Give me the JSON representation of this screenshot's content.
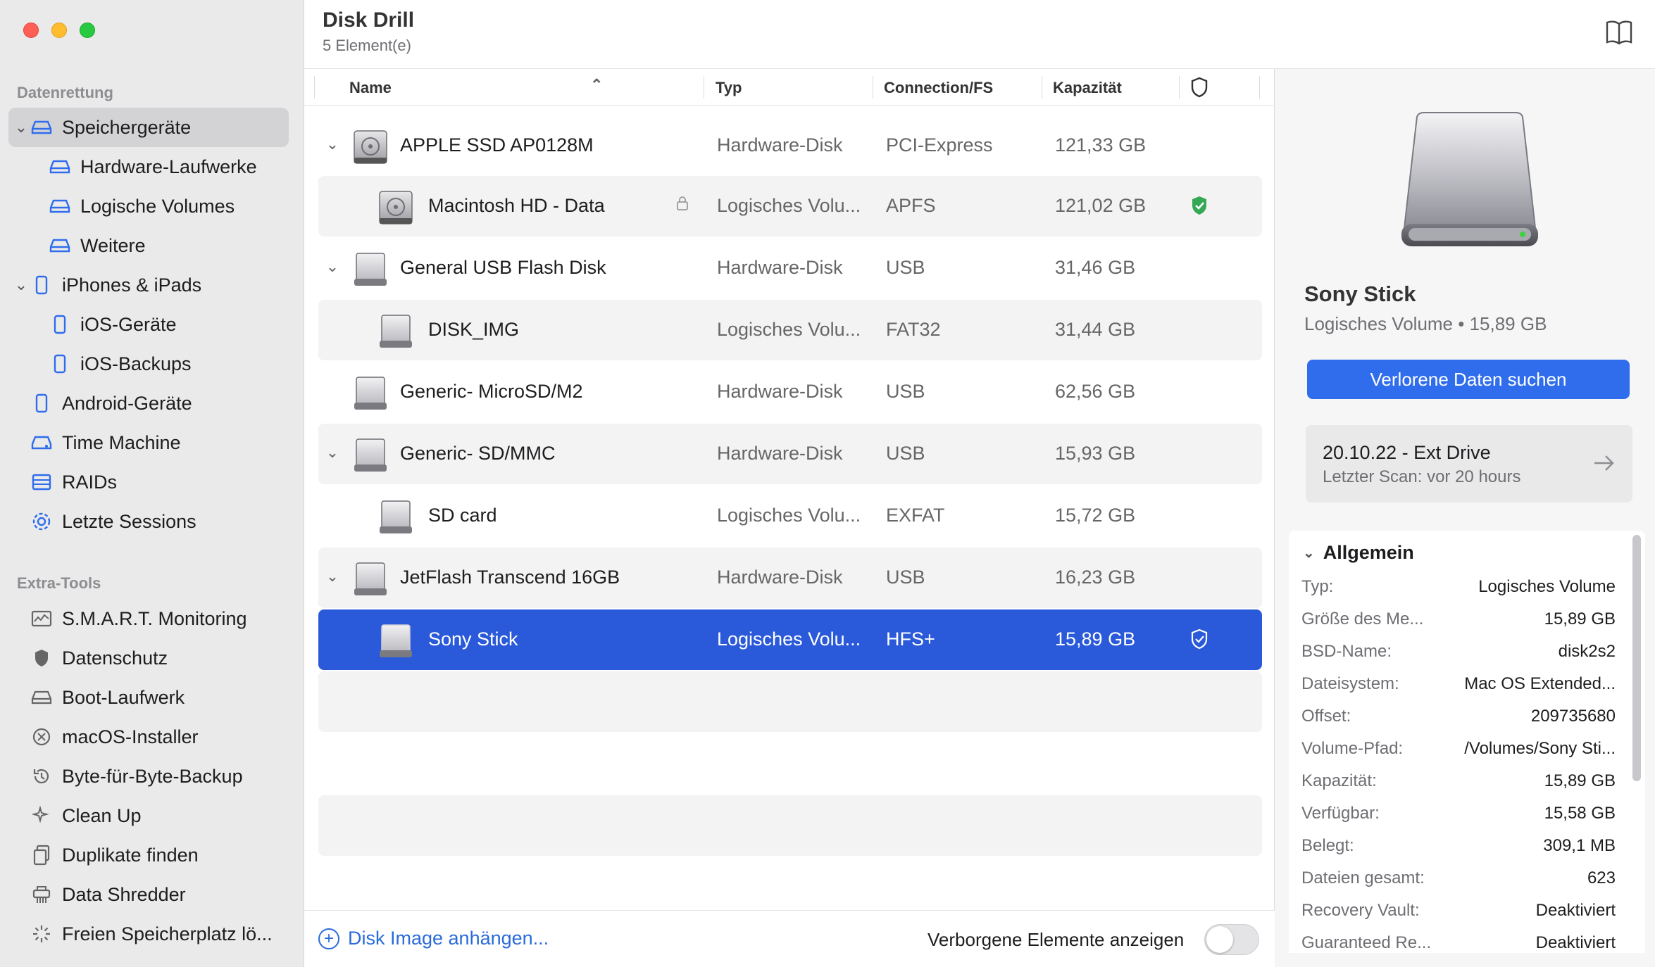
{
  "sidebar": {
    "section_recovery": "Datenrettung",
    "section_tools": "Extra-Tools",
    "recovery_items": [
      {
        "label": "Speichergeräte"
      },
      {
        "label": "Hardware-Laufwerke"
      },
      {
        "label": "Logische Volumes"
      },
      {
        "label": "Weitere"
      },
      {
        "label": "iPhones & iPads"
      },
      {
        "label": "iOS-Geräte"
      },
      {
        "label": "iOS-Backups"
      },
      {
        "label": "Android-Geräte"
      },
      {
        "label": "Time Machine"
      },
      {
        "label": "RAIDs"
      },
      {
        "label": "Letzte Sessions"
      }
    ],
    "tool_items": [
      {
        "label": "S.M.A.R.T. Monitoring"
      },
      {
        "label": "Datenschutz"
      },
      {
        "label": "Boot-Laufwerk"
      },
      {
        "label": "macOS-Installer"
      },
      {
        "label": "Byte-für-Byte-Backup"
      },
      {
        "label": "Clean Up"
      },
      {
        "label": "Duplikate finden"
      },
      {
        "label": "Data Shredder"
      },
      {
        "label": "Freien Speicherplatz lö..."
      }
    ]
  },
  "header": {
    "title": "Disk Drill",
    "subtitle": "5 Element(e)"
  },
  "table": {
    "columns": {
      "name": "Name",
      "type": "Typ",
      "fs": "Connection/FS",
      "capacity": "Kapazität"
    },
    "rows": [
      {
        "name": "APPLE SSD AP0128M",
        "type": "Hardware-Disk",
        "fs": "PCI-Express",
        "capacity": "121,33 GB"
      },
      {
        "name": "Macintosh HD - Data",
        "type": "Logisches Volu...",
        "fs": "APFS",
        "capacity": "121,02 GB"
      },
      {
        "name": "General USB Flash Disk",
        "type": "Hardware-Disk",
        "fs": "USB",
        "capacity": "31,46 GB"
      },
      {
        "name": "DISK_IMG",
        "type": "Logisches Volu...",
        "fs": "FAT32",
        "capacity": "31,44 GB"
      },
      {
        "name": "Generic- MicroSD/M2",
        "type": "Hardware-Disk",
        "fs": "USB",
        "capacity": "62,56 GB"
      },
      {
        "name": "Generic- SD/MMC",
        "type": "Hardware-Disk",
        "fs": "USB",
        "capacity": "15,93 GB"
      },
      {
        "name": "SD card",
        "type": "Logisches Volu...",
        "fs": "EXFAT",
        "capacity": "15,72 GB"
      },
      {
        "name": "JetFlash Transcend 16GB",
        "type": "Hardware-Disk",
        "fs": "USB",
        "capacity": "16,23 GB"
      },
      {
        "name": "Sony Stick",
        "type": "Logisches Volu...",
        "fs": "HFS+",
        "capacity": "15,89 GB"
      }
    ]
  },
  "footer": {
    "attach_label": "Disk Image anhängen...",
    "hidden_label": "Verborgene Elemente anzeigen"
  },
  "inspector": {
    "name": "Sony Stick",
    "subtitle": "Logisches Volume • 15,89 GB",
    "scan_button": "Verlorene Daten suchen",
    "session_title": "20.10.22 - Ext Drive",
    "session_subtitle": "Letzter Scan: vor 20 hours",
    "details_title": "Allgemein",
    "details": [
      {
        "key": "Typ:",
        "value": "Logisches Volume"
      },
      {
        "key": "Größe des Me...",
        "value": "15,89 GB"
      },
      {
        "key": "BSD-Name:",
        "value": "disk2s2"
      },
      {
        "key": "Dateisystem:",
        "value": "Mac OS Extended..."
      },
      {
        "key": "Offset:",
        "value": "209735680"
      },
      {
        "key": "Volume-Pfad:",
        "value": "/Volumes/Sony Sti..."
      },
      {
        "key": "Kapazität:",
        "value": "15,89 GB"
      },
      {
        "key": "Verfügbar:",
        "value": "15,58 GB"
      },
      {
        "key": "Belegt:",
        "value": "309,1 MB"
      },
      {
        "key": "Dateien gesamt:",
        "value": "623"
      },
      {
        "key": "Recovery Vault:",
        "value": "Deaktiviert"
      },
      {
        "key": "Guaranteed Re...",
        "value": "Deaktiviert"
      }
    ]
  },
  "colors": {
    "accent": "#2a59d9",
    "button": "#2f6ded",
    "shield_green": "#34a853",
    "sidebar_bg": "#eaeaea"
  }
}
